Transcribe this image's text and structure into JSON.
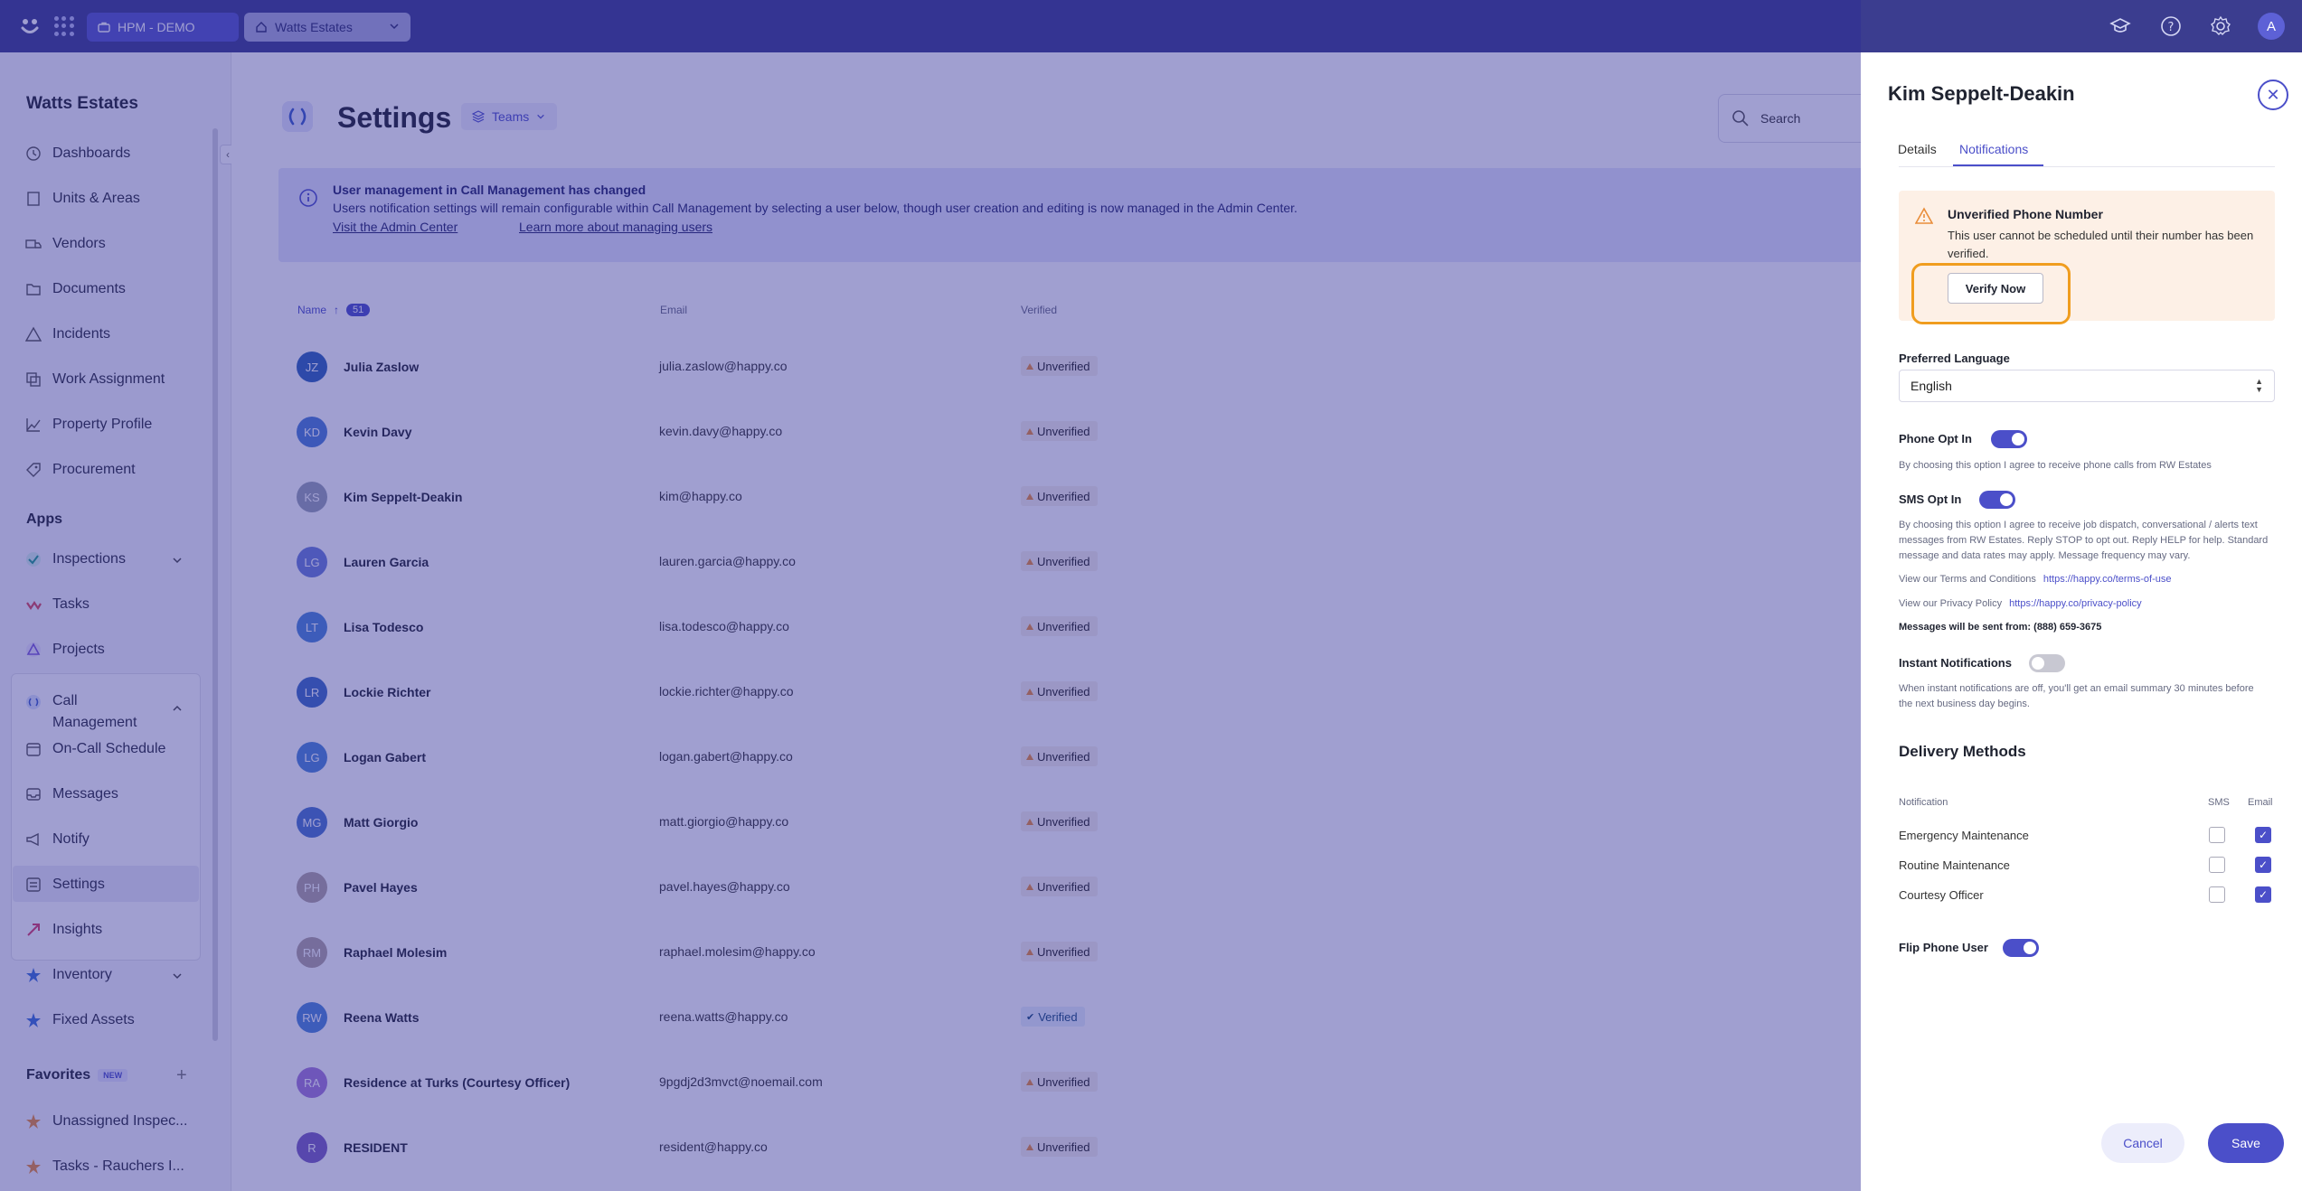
{
  "topbar": {
    "logo": "happy-logo-icon",
    "org_label": "HPM - DEMO",
    "property_label": "Watts Estates",
    "avatar_initial": "A"
  },
  "sidebar": {
    "site_name": "Watts Estates",
    "nav": [
      {
        "label": "Dashboards",
        "icon": "clock-icon"
      },
      {
        "label": "Units & Areas",
        "icon": "building-icon"
      },
      {
        "label": "Vendors",
        "icon": "truck-icon"
      },
      {
        "label": "Documents",
        "icon": "folder-icon"
      },
      {
        "label": "Incidents",
        "icon": "alert-icon"
      },
      {
        "label": "Work Assignment",
        "icon": "assignment-icon"
      },
      {
        "label": "Property Profile",
        "icon": "chart-icon"
      },
      {
        "label": "Procurement",
        "icon": "tag-icon"
      }
    ],
    "apps_label": "Apps",
    "apps": [
      {
        "label": "Inspections",
        "icon": "inspections-icon"
      },
      {
        "label": "Tasks",
        "icon": "tasks-icon"
      },
      {
        "label": "Projects",
        "icon": "projects-icon"
      },
      {
        "label": "Call Management",
        "icon": "call-management-icon"
      },
      {
        "label": "On-Call Schedule",
        "icon": "calendar-icon"
      },
      {
        "label": "Messages",
        "icon": "inbox-icon"
      },
      {
        "label": "Notify",
        "icon": "megaphone-icon"
      },
      {
        "label": "Settings",
        "icon": "settings-list-icon"
      },
      {
        "label": "Insights",
        "icon": "insights-icon"
      },
      {
        "label": "Inventory",
        "icon": "inventory-icon"
      },
      {
        "label": "Fixed Assets",
        "icon": "star-icon"
      }
    ],
    "favorites_label": "Favorites",
    "favorites_badge": "NEW",
    "favorites": [
      {
        "label": "Unassigned Inspec..."
      },
      {
        "label": "Tasks - Rauchers I..."
      }
    ]
  },
  "main": {
    "title": "Settings",
    "teams_label": "Teams",
    "search_placeholder": "Search",
    "banner": {
      "title": "User management in Call Management has changed",
      "text": "Users notification settings will remain configurable within Call Management by selecting a user below, though user creation and editing is now managed in the Admin Center.",
      "link1": "Visit the Admin Center",
      "link2": "Learn more about managing users"
    },
    "table": {
      "col_name": "Name",
      "count": "51",
      "col_email": "Email",
      "col_verified": "Verified",
      "rows": [
        {
          "initials": "JZ",
          "name": "Julia Zaslow",
          "email": "julia.zaslow@happy.co",
          "status": "Unverified",
          "color": "#2e63b8"
        },
        {
          "initials": "KD",
          "name": "Kevin Davy",
          "email": "kevin.davy@happy.co",
          "status": "Unverified",
          "color": "#4c7ed6"
        },
        {
          "initials": "KS",
          "name": "Kim Seppelt-Deakin",
          "email": "kim@happy.co",
          "status": "Unverified",
          "color": "#9aa2b3"
        },
        {
          "initials": "LG",
          "name": "Lauren Garcia",
          "email": "lauren.garcia@happy.co",
          "status": "Unverified",
          "color": "#6a7ed8"
        },
        {
          "initials": "LT",
          "name": "Lisa Todesco",
          "email": "lisa.todesco@happy.co",
          "status": "Unverified",
          "color": "#4c86d8"
        },
        {
          "initials": "LR",
          "name": "Lockie Richter",
          "email": "lockie.richter@happy.co",
          "status": "Unverified",
          "color": "#3d6cc4"
        },
        {
          "initials": "LG",
          "name": "Logan Gabert",
          "email": "logan.gabert@happy.co",
          "status": "Unverified",
          "color": "#4c86d8"
        },
        {
          "initials": "MG",
          "name": "Matt Giorgio",
          "email": "matt.giorgio@happy.co",
          "status": "Unverified",
          "color": "#4a76cc"
        },
        {
          "initials": "PH",
          "name": "Pavel Hayes",
          "email": "pavel.hayes@happy.co",
          "status": "Unverified",
          "color": "#b3a4a0"
        },
        {
          "initials": "RM",
          "name": "Raphael Molesim",
          "email": "raphael.molesim@happy.co",
          "status": "Unverified",
          "color": "#b3a4a0"
        },
        {
          "initials": "RW",
          "name": "Reena Watts",
          "email": "reena.watts@happy.co",
          "status": "Verified",
          "color": "#4c86d8"
        },
        {
          "initials": "RA",
          "name": "Residence at Turks (Courtesy Officer)",
          "email": "9pgdj2d3mvct@noemail.com",
          "status": "Unverified",
          "color": "#a57ad8"
        },
        {
          "initials": "R",
          "name": "RESIDENT",
          "email": "resident@happy.co",
          "status": "Unverified",
          "color": "#7a5fc0"
        }
      ]
    }
  },
  "drawer": {
    "title": "Kim Seppelt-Deakin",
    "tabs": [
      "Details",
      "Notifications"
    ],
    "warning": {
      "title": "Unverified Phone Number",
      "text": "This user cannot be scheduled until their number has been verified.",
      "button": "Verify Now"
    },
    "language_label": "Preferred Language",
    "language_value": "English",
    "phone_opt_in": {
      "label": "Phone Opt In",
      "on": true,
      "text": "By choosing this option I agree to receive phone calls from RW Estates"
    },
    "sms_opt_in": {
      "label": "SMS Opt In",
      "on": true,
      "text": "By choosing this option I agree to receive job dispatch, conversational / alerts text messages from RW Estates. Reply STOP to opt out. Reply HELP for help. Standard message and data rates may apply. Message frequency may vary."
    },
    "terms_label": "View our Terms and Conditions",
    "terms_link": "https://happy.co/terms-of-use",
    "privacy_label": "View our Privacy Policy",
    "privacy_link": "https://happy.co/privacy-policy",
    "sent_from": "Messages will be sent from: (888) 659-3675",
    "instant": {
      "label": "Instant Notifications",
      "on": false,
      "text": "When instant notifications are off, you'll get an email summary 30 minutes before the next business day begins."
    },
    "delivery_title": "Delivery Methods",
    "delivery_head": {
      "notification": "Notification",
      "sms": "SMS",
      "email": "Email"
    },
    "delivery_rows": [
      {
        "label": "Emergency Maintenance",
        "sms": false,
        "email": true
      },
      {
        "label": "Routine Maintenance",
        "sms": false,
        "email": true
      },
      {
        "label": "Courtesy Officer",
        "sms": false,
        "email": true
      }
    ],
    "flip_phone": {
      "label": "Flip Phone User",
      "on": true
    },
    "cancel_label": "Cancel",
    "save_label": "Save"
  }
}
